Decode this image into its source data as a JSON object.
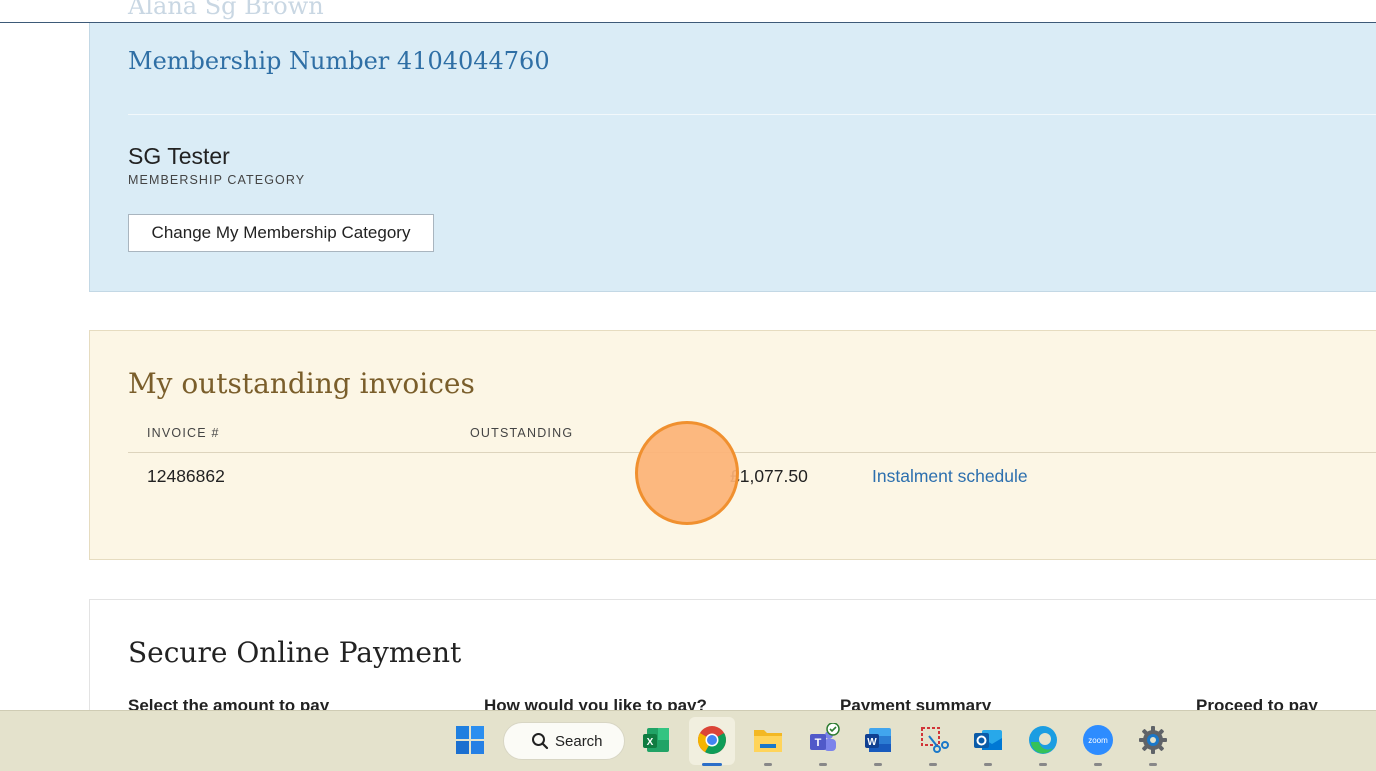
{
  "header": {
    "member_name": "Alana Sg Brown"
  },
  "membership": {
    "number_label": "Membership Number 4104044760",
    "category_value": "SG Tester",
    "category_label": "MEMBERSHIP CATEGORY",
    "change_button": "Change My Membership Category"
  },
  "invoices": {
    "title": "My outstanding invoices",
    "columns": [
      "INVOICE #",
      "OUTSTANDING"
    ],
    "rows": [
      {
        "invoice": "12486862",
        "amount": "£1,077.50",
        "link": "Instalment schedule"
      }
    ]
  },
  "payment": {
    "title": "Secure Online Payment",
    "steps": [
      "Select the amount to pay",
      "How would you like to pay?",
      "Payment summary",
      "Proceed to pay"
    ]
  },
  "taskbar": {
    "search_label": "Search",
    "apps": [
      "start-icon",
      "excel-icon",
      "chrome-icon",
      "file-explorer-icon",
      "teams-icon",
      "word-icon",
      "snipping-tool-icon",
      "outlook-icon",
      "edge-icon",
      "zoom-icon",
      "settings-icon"
    ]
  },
  "colors": {
    "member_panel_bg": "#daecf6",
    "invoice_panel_bg": "#fcf6e5",
    "link": "#2c6fae",
    "invoice_title": "#7a5e2b",
    "click_marker": "#fcb276"
  }
}
